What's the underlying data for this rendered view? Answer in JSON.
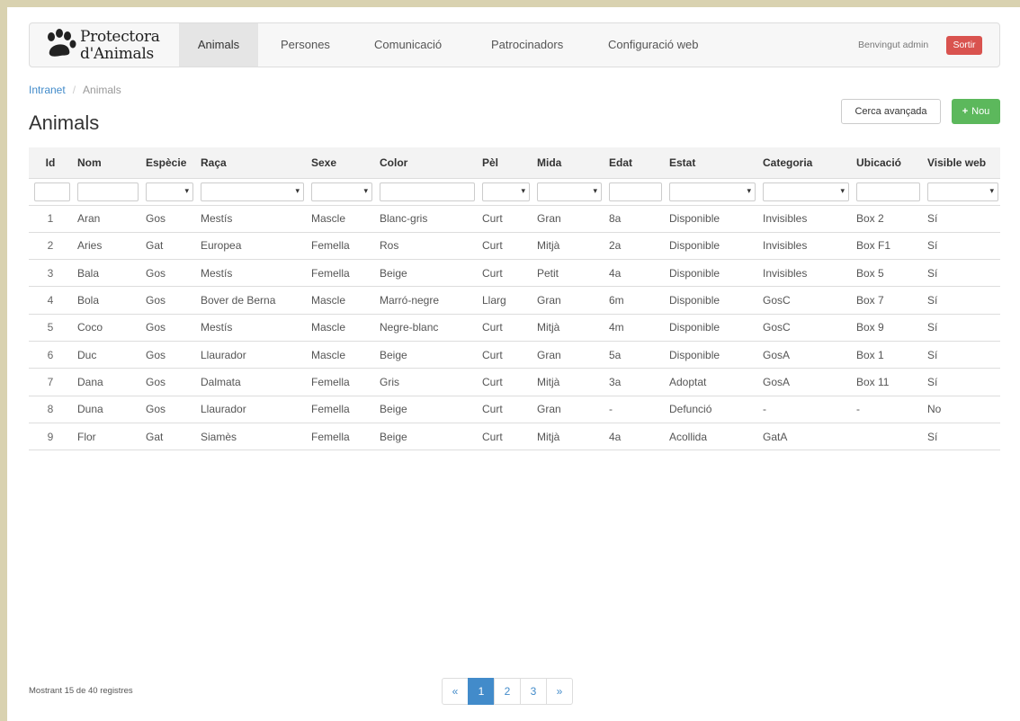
{
  "navbar": {
    "brand_line1": "Protectora",
    "brand_line2": "d'Animals",
    "items": [
      {
        "label": "Animals",
        "active": true
      },
      {
        "label": "Persones"
      },
      {
        "label": "Comunicació"
      },
      {
        "label": "Patrocinadors"
      },
      {
        "label": "Configuració web"
      }
    ],
    "welcome": "Benvingut admin",
    "logout": "Sortir"
  },
  "breadcrumb": {
    "root": "Intranet",
    "sep": "/",
    "current": "Animals"
  },
  "page_title": "Animals",
  "actions": {
    "advanced_search": "Cerca avançada",
    "new_plus": "+",
    "new": "Nou"
  },
  "table": {
    "columns": [
      "Id",
      "Nom",
      "Espècie",
      "Raça",
      "Sexe",
      "Color",
      "Pèl",
      "Mida",
      "Edat",
      "Estat",
      "Categoria",
      "Ubicació",
      "Visible web"
    ],
    "rows": [
      [
        "1",
        "Aran",
        "Gos",
        "Mestís",
        "Mascle",
        "Blanc-gris",
        "Curt",
        "Gran",
        "8a",
        "Disponible",
        "Invisibles",
        "Box 2",
        "Sí"
      ],
      [
        "2",
        "Aries",
        "Gat",
        "Europea",
        "Femella",
        "Ros",
        "Curt",
        "Mitjà",
        "2a",
        "Disponible",
        "Invisibles",
        "Box F1",
        "Sí"
      ],
      [
        "3",
        "Bala",
        "Gos",
        "Mestís",
        "Femella",
        "Beige",
        "Curt",
        "Petit",
        "4a",
        "Disponible",
        "Invisibles",
        "Box 5",
        "Sí"
      ],
      [
        "4",
        "Bola",
        "Gos",
        "Bover de Berna",
        "Mascle",
        "Marró-negre",
        "Llarg",
        "Gran",
        "6m",
        "Disponible",
        "GosC",
        "Box 7",
        "Sí"
      ],
      [
        "5",
        "Coco",
        "Gos",
        "Mestís",
        "Mascle",
        "Negre-blanc",
        "Curt",
        "Mitjà",
        "4m",
        "Disponible",
        "GosC",
        "Box 9",
        "Sí"
      ],
      [
        "6",
        "Duc",
        "Gos",
        "Llaurador",
        "Mascle",
        "Beige",
        "Curt",
        "Gran",
        "5a",
        "Disponible",
        "GosA",
        "Box 1",
        "Sí"
      ],
      [
        "7",
        "Dana",
        "Gos",
        "Dalmata",
        "Femella",
        "Gris",
        "Curt",
        "Mitjà",
        "3a",
        "Adoptat",
        "GosA",
        "Box 11",
        "Sí"
      ],
      [
        "8",
        "Duna",
        "Gos",
        "Llaurador",
        "Femella",
        "Beige",
        "Curt",
        "Gran",
        "-",
        "Defunció",
        "-",
        "-",
        "No"
      ],
      [
        "9",
        "Flor",
        "Gat",
        "Siamès",
        "Femella",
        "Beige",
        "Curt",
        "Mitjà",
        "4a",
        "Acollida",
        "GatA",
        "",
        "Sí"
      ]
    ]
  },
  "footer": {
    "count_text": "Mostrant 15 de 40 registres",
    "pager": [
      "«",
      "1",
      "2",
      "3",
      "»"
    ],
    "active_page": "1"
  },
  "colors": {
    "primary": "#428bca",
    "success": "#5cb85c",
    "danger": "#d9534f",
    "frame": "#d9d2b0"
  }
}
